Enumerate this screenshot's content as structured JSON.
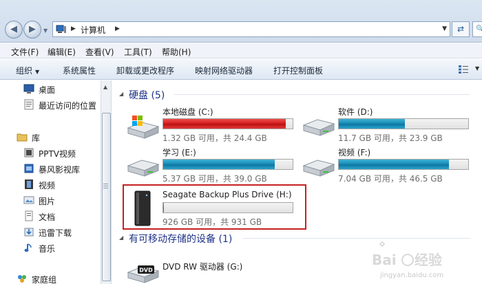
{
  "address": {
    "location": "计算机"
  },
  "menu": [
    "文件(F)",
    "编辑(E)",
    "查看(V)",
    "工具(T)",
    "帮助(H)"
  ],
  "toolbar": {
    "organize": "组织",
    "system_properties": "系统属性",
    "uninstall": "卸载或更改程序",
    "map_drive": "映射网络驱动器",
    "control_panel": "打开控制面板"
  },
  "nav": {
    "favorites": [
      "桌面",
      "最近访问的位置"
    ],
    "libraries_label": "库",
    "libraries": [
      "PPTV视频",
      "暴风影视库",
      "视频",
      "图片",
      "文档",
      "迅雷下载",
      "音乐"
    ],
    "homegroup": "家庭组"
  },
  "groups": {
    "hard_disks": "硬盘 (5)",
    "removable": "有可移动存储的设备 (1)"
  },
  "drives": [
    {
      "name": "本地磁盘 (C:)",
      "info": "1.32 GB 可用，共 24.4 GB",
      "used_fraction": 0.946,
      "color": "#d01a1a"
    },
    {
      "name": "软件 (D:)",
      "info": "11.7 GB 可用，共 23.9 GB",
      "used_fraction": 0.51,
      "color": "#1687b1"
    },
    {
      "name": "学习 (E:)",
      "info": "5.37 GB 可用，共 39.0 GB",
      "used_fraction": 0.862,
      "color": "#1687b1"
    },
    {
      "name": "视频 (F:)",
      "info": "7.04 GB 可用，共 46.5 GB",
      "used_fraction": 0.849,
      "color": "#1687b1"
    },
    {
      "name": "Seagate Backup Plus Drive (H:)",
      "info": "926 GB 可用，共 931 GB",
      "used_fraction": 0.005,
      "color": "#1687b1"
    }
  ],
  "removable": [
    {
      "name": "DVD RW 驱动器 (G:)",
      "icon_label": "DVD"
    }
  ],
  "watermark": {
    "site": "jingyan.baidu.com"
  }
}
